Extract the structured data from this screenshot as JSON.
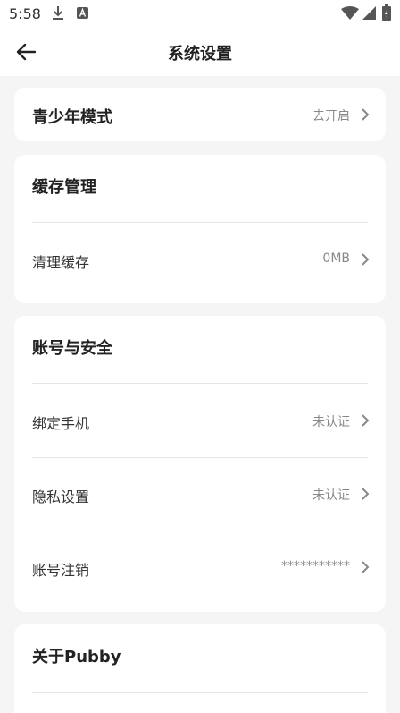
{
  "status_bar": {
    "time": "5:58",
    "icons": [
      "download-icon",
      "a-notification-icon",
      "wifi-icon",
      "signal-icon",
      "battery-icon"
    ]
  },
  "header": {
    "title": "系统设置",
    "back_icon": "back-arrow-icon"
  },
  "sections": {
    "youth": {
      "label": "青少年模式",
      "value": "去开启"
    },
    "cache": {
      "title": "缓存管理",
      "clear_label": "清理缓存",
      "clear_value": "0MB"
    },
    "account": {
      "title": "账号与安全",
      "items": [
        {
          "label": "绑定手机",
          "value": "未认证"
        },
        {
          "label": "隐私设置",
          "value": "未认证"
        },
        {
          "label": "账号注销",
          "value": "***********"
        }
      ]
    },
    "about": {
      "title": "关于Pubby"
    }
  },
  "colors": {
    "background": "#f5f5f5",
    "card": "#ffffff",
    "value_text": "#888888",
    "divider": "#e6e6e6"
  }
}
